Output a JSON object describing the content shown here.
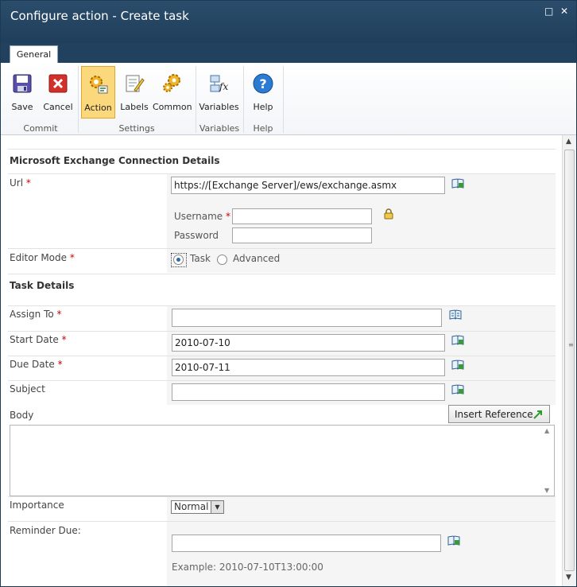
{
  "window": {
    "title": "Configure action - Create task",
    "maximize_glyph": "□",
    "close_glyph": "✕"
  },
  "ribbon": {
    "tab": "General",
    "buttons": {
      "save": "Save",
      "cancel": "Cancel",
      "action": "Action",
      "labels": "Labels",
      "common": "Common",
      "variables": "Variables",
      "help": "Help"
    },
    "groups": {
      "commit": "Commit",
      "settings": "Settings",
      "variables": "Variables",
      "help": "Help"
    }
  },
  "form": {
    "exchange_section_title": "Microsoft Exchange Connection Details",
    "url": {
      "label": "Url",
      "value": "https://[Exchange Server]/ews/exchange.asmx"
    },
    "username": {
      "label": "Username",
      "value": ""
    },
    "password": {
      "label": "Password",
      "value": ""
    },
    "editor_mode": {
      "label": "Editor Mode",
      "options": [
        "Task",
        "Advanced"
      ],
      "selected": "Task"
    },
    "task_section_title": "Task Details",
    "assign_to": {
      "label": "Assign To",
      "value": ""
    },
    "start_date": {
      "label": "Start Date",
      "value": "2010-07-10"
    },
    "due_date": {
      "label": "Due Date",
      "value": "2010-07-11"
    },
    "subject": {
      "label": "Subject",
      "value": ""
    },
    "body": {
      "label": "Body",
      "value": ""
    },
    "insert_reference": "Insert Reference",
    "importance": {
      "label": "Importance",
      "value": "Normal"
    },
    "reminder_due": {
      "label": "Reminder Due:",
      "value": "",
      "example": "Example: 2010-07-10T13:00:00"
    },
    "required_marker": "*"
  },
  "colors": {
    "title_bar": "#1f3e5b",
    "active_button": "#fcd87c",
    "required": "#cc0000"
  }
}
